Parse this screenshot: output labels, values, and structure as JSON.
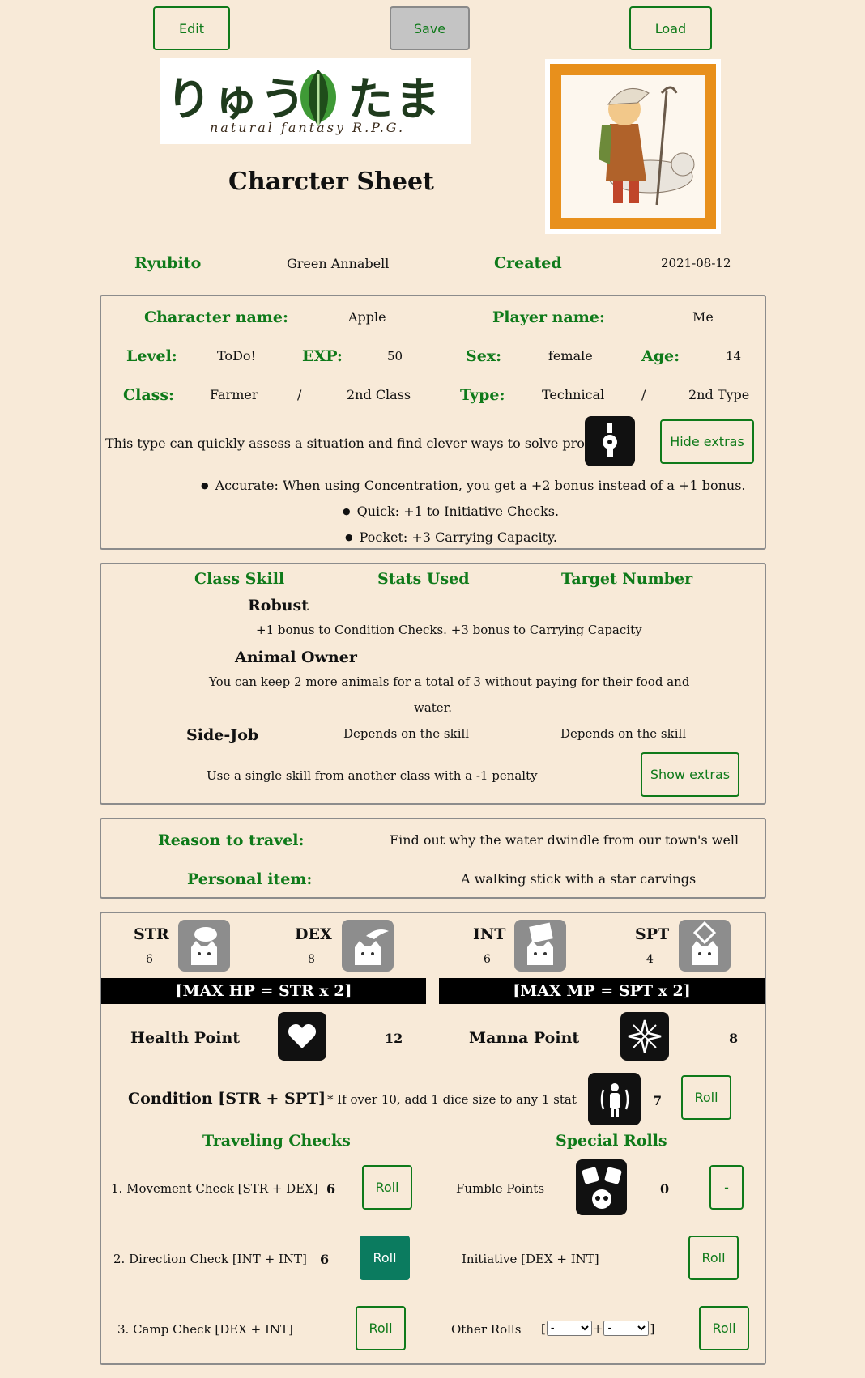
{
  "toolbar": {
    "edit": "Edit",
    "save": "Save",
    "load": "Load"
  },
  "logo": {
    "text": "りゅう",
    "text2": "たま",
    "tagline": "natural fantasy R.P.G."
  },
  "page_title": "Charcter Sheet",
  "header": {
    "race_label": "Ryubito",
    "race_value": "Green Annabell",
    "created_label": "Created",
    "created_value": "2021-08-12"
  },
  "character": {
    "name_label": "Character name:",
    "name_value": "Apple",
    "player_label": "Player name:",
    "player_value": "Me",
    "level_label": "Level:",
    "level_value": "ToDo!",
    "exp_label": "EXP:",
    "exp_value": "50",
    "sex_label": "Sex:",
    "sex_value": "female",
    "age_label": "Age:",
    "age_value": "14",
    "class_label": "Class:",
    "class_value": "Farmer",
    "class_sep": "/",
    "class2_value": "2nd Class",
    "type_label": "Type:",
    "type_value": "Technical",
    "type_sep": "/",
    "type2_value": "2nd Type",
    "type_desc": "This type can quickly assess a situation and find clever ways to solve problems.",
    "hide_extras": "Hide extras",
    "bullets": [
      "Accurate: When using Concentration, you get a +2 bonus instead of a +1 bonus.",
      "Quick: +1 to Initiative Checks.",
      "Pocket: +3 Carrying Capacity."
    ]
  },
  "skills": {
    "col1": "Class Skill",
    "col2": "Stats Used",
    "col3": "Target Number",
    "robust_name": "Robust",
    "robust_desc": "+1 bonus to Condition Checks. +3 bonus to Carrying Capacity",
    "animal_name": "Animal Owner",
    "animal_desc1": "You can keep 2 more animals for a total of 3 without paying for their food and",
    "animal_desc2": "water.",
    "sidejob_name": "Side-Job",
    "sidejob_stats": "Depends on the skill",
    "sidejob_target": "Depends on the skill",
    "sidejob_desc": "Use a single skill from another class with a -1 penalty",
    "show_extras": "Show extras"
  },
  "travel": {
    "reason_label": "Reason to travel:",
    "reason_value": "Find out why the water dwindle from our town's well",
    "item_label": "Personal item:",
    "item_value": "A walking stick with a star carvings"
  },
  "stats": {
    "str_label": "STR",
    "str_value": "6",
    "dex_label": "DEX",
    "dex_value": "8",
    "int_label": "INT",
    "int_value": "6",
    "spt_label": "SPT",
    "spt_value": "4",
    "hp_banner": "[MAX HP = STR x 2]",
    "mp_banner": "[MAX MP = SPT x 2]",
    "hp_label": "Health Point",
    "hp_value": "12",
    "mp_label": "Manna Point",
    "mp_value": "8",
    "condition_label": "Condition [STR + SPT]",
    "condition_note": "* If over 10, add 1 dice size to any 1 stat",
    "condition_value": "7",
    "roll": "Roll"
  },
  "checks": {
    "travel_title": "Traveling Checks",
    "special_title": "Special Rolls",
    "movement_label": "1. Movement Check [STR + DEX]",
    "movement_value": "6",
    "direction_label": "2. Direction Check [INT + INT]",
    "direction_value": "6",
    "camp_label": "3. Camp Check [DEX + INT]",
    "fumble_label": "Fumble Points",
    "fumble_value": "0",
    "fumble_button": "-",
    "initiative_label": "Initiative [DEX + INT]",
    "other_label": "Other Rolls",
    "bracket_open": "[",
    "plus": "+",
    "bracket_close": "]",
    "select_a": "-",
    "select_b": "-"
  }
}
